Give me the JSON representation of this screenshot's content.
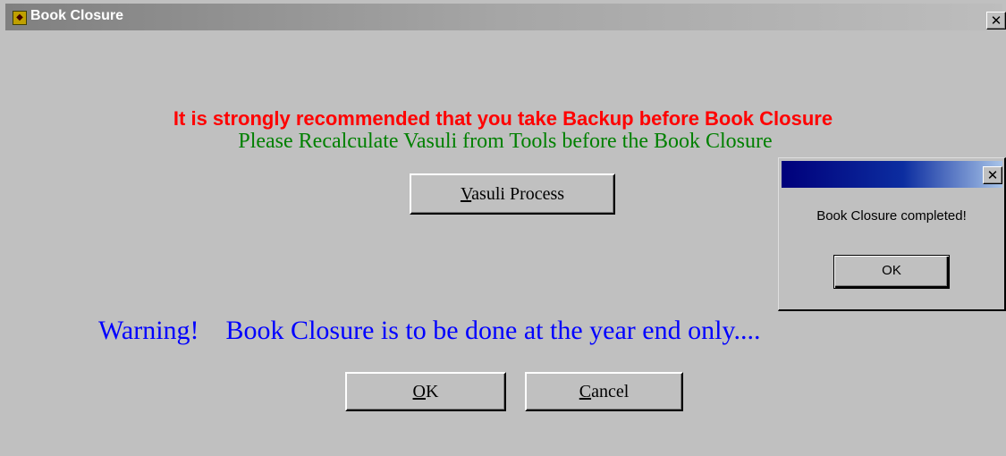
{
  "window": {
    "title": "Book Closure",
    "close_glyph": "✕",
    "icon": "app-icon"
  },
  "messages": {
    "backup_recommendation": "It is strongly recommended that you take Backup before Book Closure",
    "recalculate_notice": "Please Recalculate Vasuli from Tools before the Book Closure",
    "warning": "Warning!    Book Closure is to be done at the year end only...."
  },
  "buttons": {
    "vasuli_accel": "V",
    "vasuli_rest": "asuli Process",
    "ok_accel": "O",
    "ok_rest": "K",
    "cancel_accel": "C",
    "cancel_rest": "ancel"
  },
  "popup": {
    "message": "Book Closure completed!",
    "ok_label": "OK",
    "close_glyph": "✕"
  },
  "colors": {
    "backup_text": "#ff0000",
    "recalculate_text": "#008000",
    "warning_text": "#0000ff",
    "dialog_bg": "#c0c0c0"
  }
}
